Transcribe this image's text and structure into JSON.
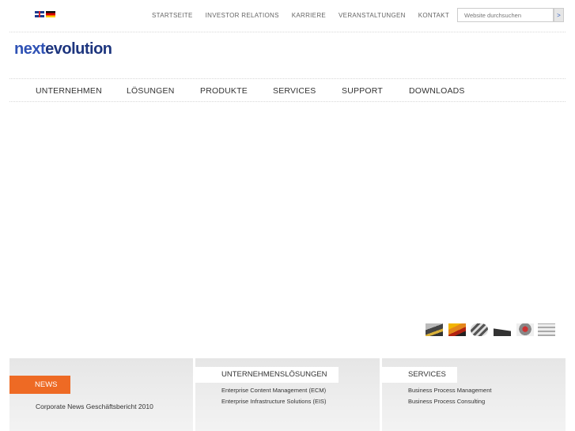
{
  "languages": [
    {
      "icon": "uk-flag-icon",
      "label": "English"
    },
    {
      "icon": "germany-flag-icon",
      "label": "Deutsch"
    }
  ],
  "topnav": [
    "STARTSEITE",
    "INVESTOR RELATIONS",
    "KARRIERE",
    "VERANSTALTUNGEN",
    "KONTAKT"
  ],
  "search": {
    "placeholder": "Website durchsuchen",
    "button": ">"
  },
  "logo": {
    "part1": "next",
    "part2": "evolution"
  },
  "mainnav": [
    "UNTERNEHMEN",
    "LÖSUNGEN",
    "PRODUKTE",
    "SERVICES",
    "SUPPORT",
    "DOWNLOADS"
  ],
  "news": {
    "tab": "NEWS",
    "item": "Corporate News Geschäftsbericht 2010"
  },
  "solutions": {
    "tab": "UNTERNEHMENSLÖSUNGEN",
    "links": [
      "Enterprise Content Management (ECM)",
      "Enterprise Infrastructure Solutions (EIS)"
    ]
  },
  "services": {
    "tab": "SERVICES",
    "links": [
      "Business Process Management",
      "Business Process Consulting"
    ]
  },
  "colors": {
    "accent": "#ee6a24",
    "brand_blue": "#2f52b5",
    "brand_dark_blue": "#1d357e"
  }
}
